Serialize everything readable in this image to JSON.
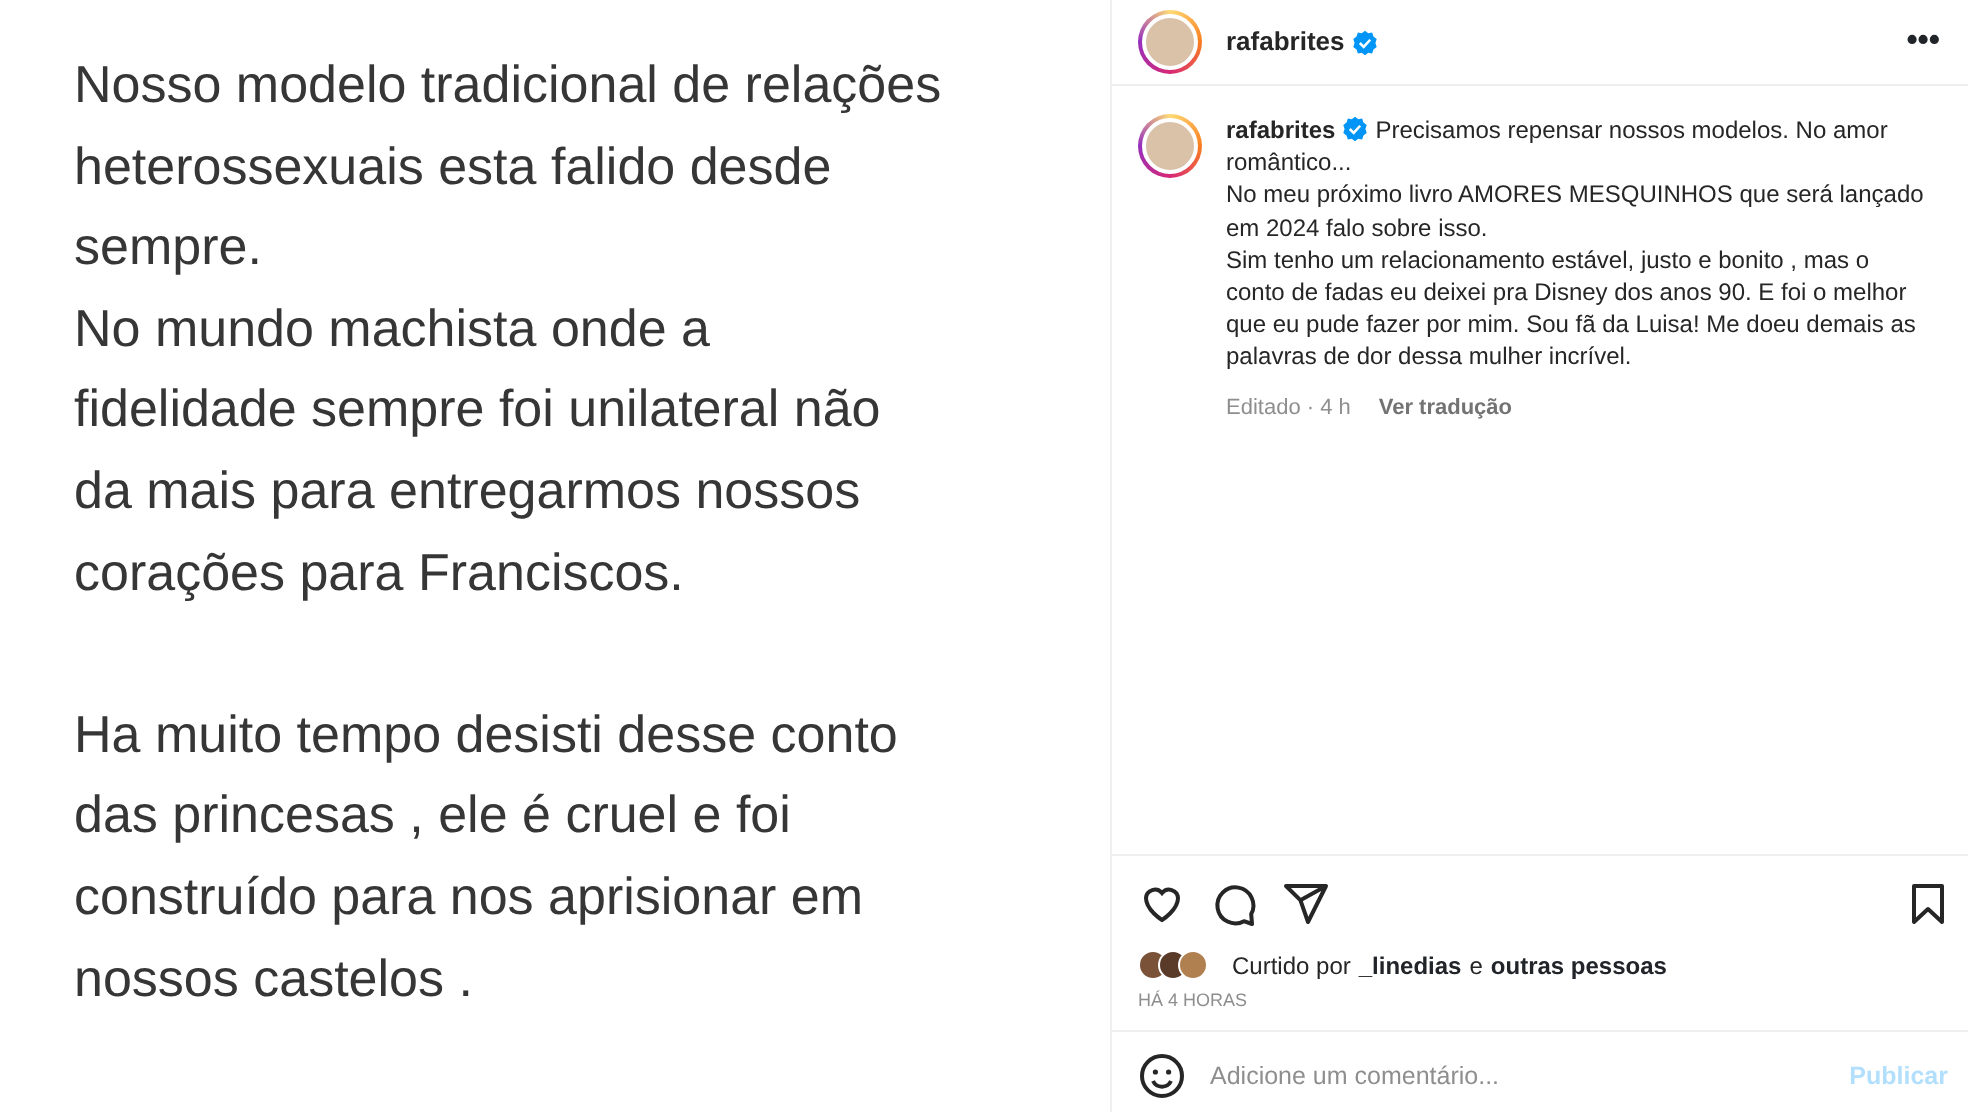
{
  "image_text": {
    "paragraphs": [
      [
        "Nosso modelo tradicional de relações",
        "heterossexuais esta falido desde",
        "sempre.",
        "No mundo machista onde a",
        "fidelidade sempre foi unilateral não",
        "da mais para entregarmos nossos",
        "corações para Franciscos."
      ],
      [
        "Ha muito tempo desisti desse conto",
        "das princesas , ele é  cruel e foi",
        "construído para nos aprisionar em",
        "nossos castelos ."
      ]
    ]
  },
  "header": {
    "username": "rafabrites",
    "verified": true,
    "more": "•••"
  },
  "caption": {
    "username": "rafabrites",
    "verified": true,
    "lines": [
      "Precisamos repensar nossos modelos. No amor",
      "romântico...",
      "No meu próximo livro AMORES MESQUINHOS que será lançado",
      "em 2024 falo sobre isso.",
      "Sim tenho um relacionamento estável, justo e bonito , mas o",
      "conto de fadas eu deixei pra Disney dos anos 90. E foi o melhor",
      "que eu pude fazer por mim. Sou fã da Luisa! Me doeu demais as",
      "palavras de dor dessa mulher incrível."
    ],
    "edited": "Editado · 4 h",
    "translate": "Ver tradução"
  },
  "actions": {
    "liked": false,
    "saved": false
  },
  "likes": {
    "prefix": "Curtido por",
    "user": "_linedias",
    "joiner": "e",
    "others": "outras pessoas"
  },
  "time": "HÁ 4 HORAS",
  "comment": {
    "placeholder": "Adicione um comentário...",
    "publish": "Publicar",
    "publish_disabled": true
  }
}
